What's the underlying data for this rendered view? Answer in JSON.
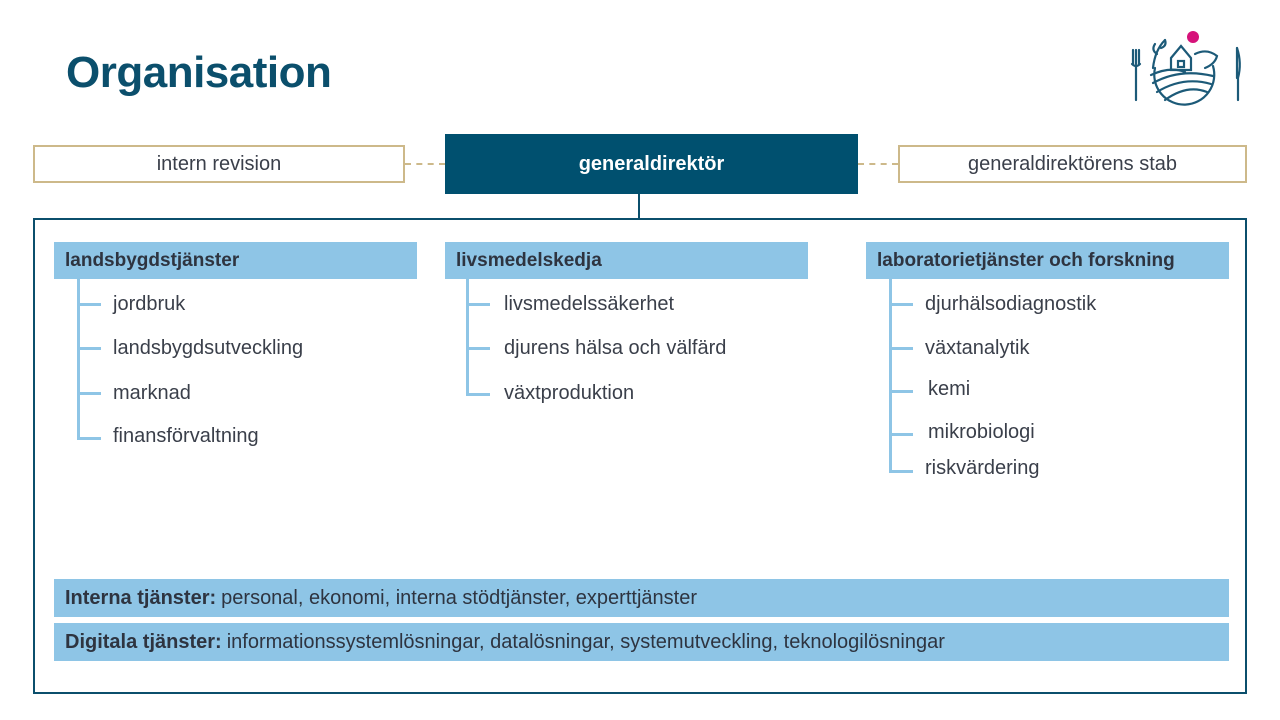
{
  "title": "Organisation",
  "logo": {
    "icon": "ruokavirasto-logo-icon",
    "accent_color": "#d6127a",
    "line_color": "#1c5a78"
  },
  "top_row": {
    "left_box": "intern revision",
    "center_box": "generaldirektör",
    "right_box": "generaldirektörens stab"
  },
  "departments": [
    {
      "name": "landsbygdstjänster",
      "units": [
        "jordbruk",
        "landsbygdsutveckling",
        "marknad",
        "finansförvaltning"
      ]
    },
    {
      "name": "livsmedelskedja",
      "units": [
        "livsmedelssäkerhet",
        "djurens hälsa och välfärd",
        "växtproduktion"
      ]
    },
    {
      "name": "laboratorietjänster och forskning",
      "units": [
        "djurhälsodiagnostik",
        "växtanalytik",
        "kemi",
        "mikrobiologi",
        "riskvärdering"
      ]
    }
  ],
  "bottom_bars": [
    {
      "label": "Interna tjänster:",
      "text": "personal, ekonomi, interna stödtjänster, experttjänster"
    },
    {
      "label": "Digitala tjänster:",
      "text": "informationssystemlösningar, datalösningar, systemutveckling, teknologilösningar"
    }
  ],
  "colors": {
    "primary": "#00506f",
    "light_blue": "#8ec5e6",
    "gold_border": "#cdb98a",
    "title_color": "#0b4f6c"
  }
}
